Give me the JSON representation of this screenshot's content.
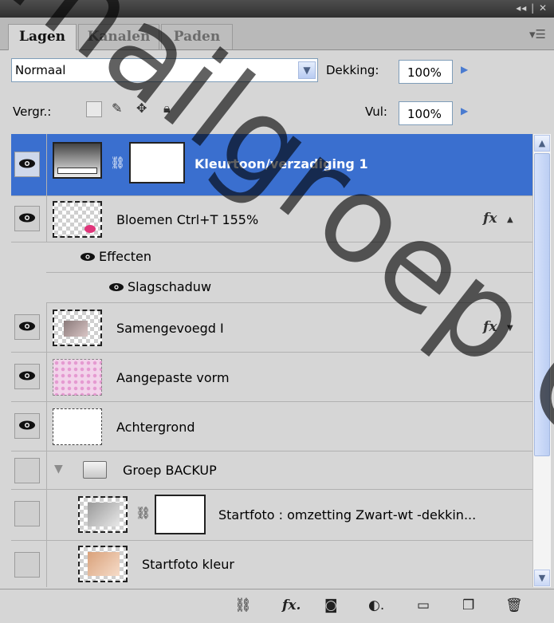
{
  "window": {
    "controls": "◂◂ | ✕"
  },
  "tabs": [
    {
      "label": "Lagen",
      "active": true
    },
    {
      "label": "Kanalen",
      "active": false
    },
    {
      "label": "Paden",
      "active": false
    }
  ],
  "blend": {
    "mode": "Normaal",
    "opacity_label": "Dekking:",
    "opacity_value": "100%",
    "lock_label": "Vergr.:",
    "fill_label": "Vul:",
    "fill_value": "100%"
  },
  "icons": {
    "menu": "panel-menu-icon",
    "eye": "eye-icon",
    "link": "chain-link-icon",
    "folder": "folder-icon",
    "fx": "fx-icon"
  },
  "layers": [
    {
      "name": "Kleurtoon/verzadiging 1",
      "visible": true,
      "selected": true
    },
    {
      "name": "Bloemen Ctrl+T 155%",
      "visible": true,
      "has_fx": true
    },
    {
      "name": "Effecten",
      "visible": true
    },
    {
      "name": "Slagschaduw",
      "visible": true
    },
    {
      "name": "Samengevoegd I",
      "visible": true,
      "has_fx": true
    },
    {
      "name": "Aangepaste vorm",
      "visible": true
    },
    {
      "name": "Achtergrond",
      "visible": true
    },
    {
      "name": "Groep BACKUP",
      "visible": false,
      "group": true
    },
    {
      "name": "Startfoto : omzetting Zwart-wt -dekkin...",
      "visible": false
    },
    {
      "name": "Startfoto kleur",
      "visible": false
    }
  ],
  "fx_label": "fx",
  "watermark": "mailgroep Co",
  "colors": {
    "selection": "#3a6fcf",
    "panel": "#d6d6d6"
  }
}
